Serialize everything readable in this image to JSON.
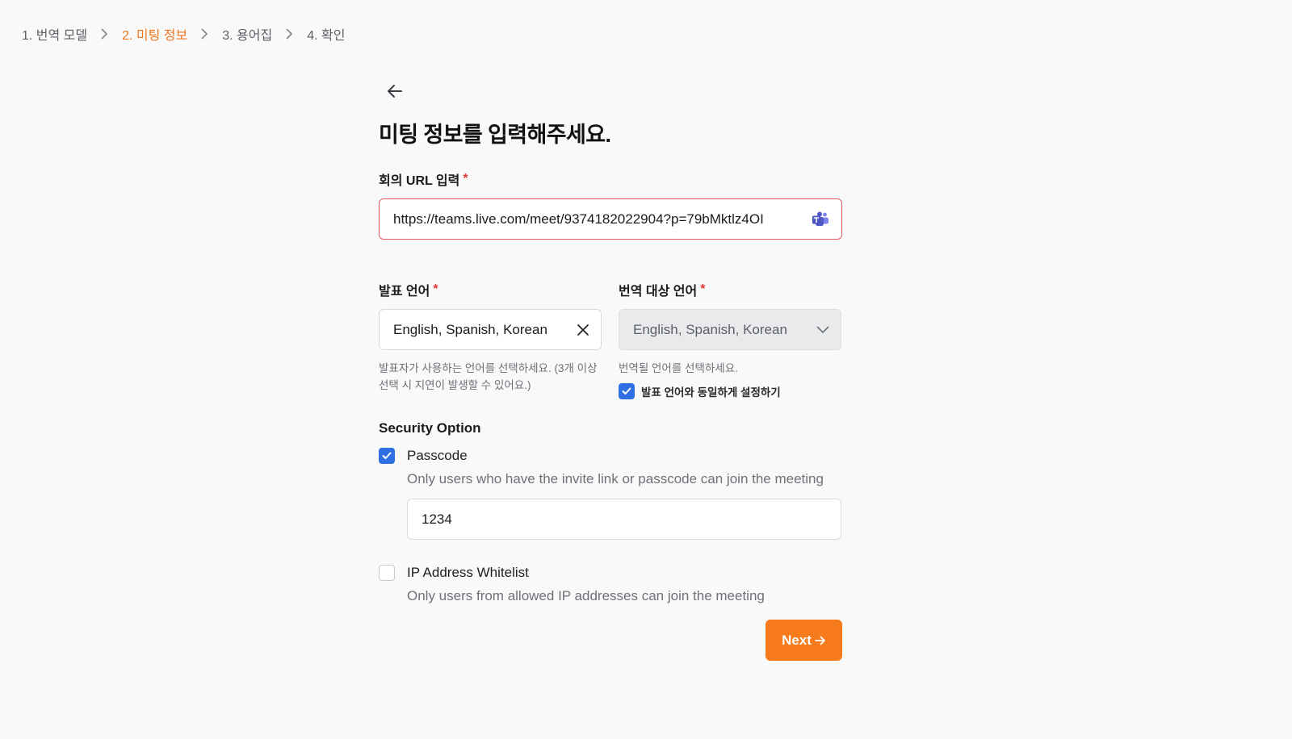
{
  "stepper": {
    "steps": [
      {
        "label": "1. 번역 모델",
        "active": false
      },
      {
        "label": "2. 미팅 정보",
        "active": true
      },
      {
        "label": "3. 용어집",
        "active": false
      },
      {
        "label": "4. 확인",
        "active": false
      }
    ],
    "active_color": "#f2761c"
  },
  "form": {
    "title": "미팅 정보를 입력해주세요.",
    "url": {
      "label": "회의 URL 입력",
      "required_mark": "*",
      "value": "https://teams.live.com/meet/9374182022904?p=79bMktlz4OI",
      "icon": "teams-icon"
    },
    "speaker_language": {
      "label": "발표 언어",
      "required_mark": "*",
      "value": "English, Spanish, Korean",
      "helper": "발표자가 사용하는 언어를 선택하세요. (3개 이상 선택 시 지연이 발생할 수 있어요.)",
      "icon": "close-icon"
    },
    "target_language": {
      "label": "번역 대상 언어",
      "required_mark": "*",
      "value": "English, Spanish, Korean",
      "helper": "번역될 언어를 선택하세요.",
      "same_as_speaker_label": "발표 언어와 동일하게 설정하기",
      "same_as_speaker_checked": true,
      "icon": "chevron-down-icon"
    },
    "security": {
      "title": "Security Option",
      "passcode": {
        "checked": true,
        "title": "Passcode",
        "description": "Only users who have the invite link or passcode can join the meeting",
        "value": "1234"
      },
      "ip_whitelist": {
        "checked": false,
        "title": "IP Address Whitelist",
        "description": "Only users from allowed IP addresses can join the meeting"
      }
    },
    "next_label": "Next"
  },
  "colors": {
    "accent": "#f77b1b",
    "checkbox": "#2f6fe4",
    "error_border": "#e05a5a",
    "required": "#e53935"
  }
}
